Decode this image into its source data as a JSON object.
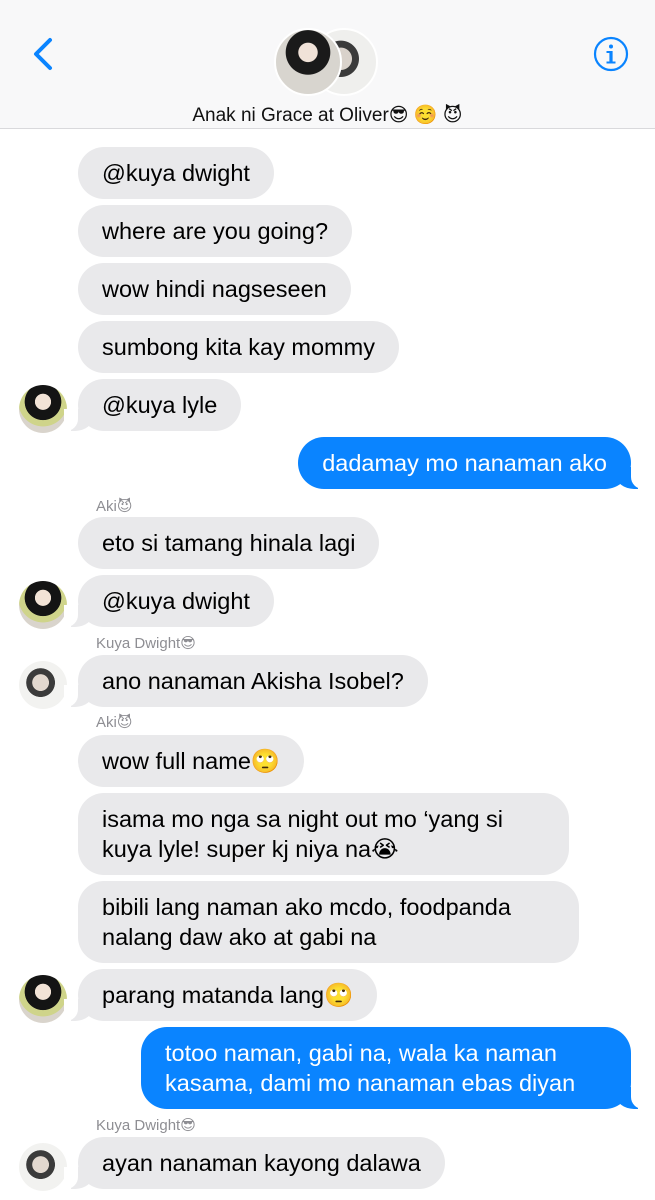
{
  "header": {
    "back_icon": "chevron-left-icon",
    "info_icon": "info-circle-icon",
    "title": "Anak ni Grace at Oliver😎 ☺️ 😈",
    "accent_color": "#0a84ff"
  },
  "messages": [
    {
      "kind": "in",
      "text": "@kuya dwight"
    },
    {
      "kind": "in",
      "text": "where are you going?"
    },
    {
      "kind": "in",
      "text": "wow hindi nagseseen"
    },
    {
      "kind": "in",
      "text": "sumbong kita kay mommy"
    },
    {
      "kind": "in",
      "text": "@kuya lyle",
      "avatar": "aki"
    },
    {
      "kind": "out",
      "text": "dadamay mo nanaman ako"
    },
    {
      "kind": "sender",
      "text": "Aki😈"
    },
    {
      "kind": "in",
      "text": "eto si tamang hinala lagi"
    },
    {
      "kind": "in",
      "text": "@kuya dwight",
      "avatar": "aki"
    },
    {
      "kind": "sender",
      "text": "Kuya Dwight😎"
    },
    {
      "kind": "in",
      "text": "ano nanaman Akisha Isobel?",
      "avatar": "dwight"
    },
    {
      "kind": "sender",
      "text": "Aki😈"
    },
    {
      "kind": "in",
      "text": "wow full name🙄"
    },
    {
      "kind": "in",
      "text": "isama mo nga sa night out mo ‘yang si kuya lyle! super kj niya na😭"
    },
    {
      "kind": "in",
      "text": "bibili lang naman ako mcdo, foodpanda nalang daw ako at gabi na"
    },
    {
      "kind": "in",
      "text": "parang matanda lang🙄",
      "avatar": "aki"
    },
    {
      "kind": "out",
      "text": "totoo naman, gabi na, wala ka naman kasama, dami mo nanaman ebas diyan"
    },
    {
      "kind": "sender",
      "text": "Kuya Dwight😎"
    },
    {
      "kind": "in",
      "text": "ayan nanaman kayong dalawa",
      "avatar": "dwight"
    }
  ]
}
